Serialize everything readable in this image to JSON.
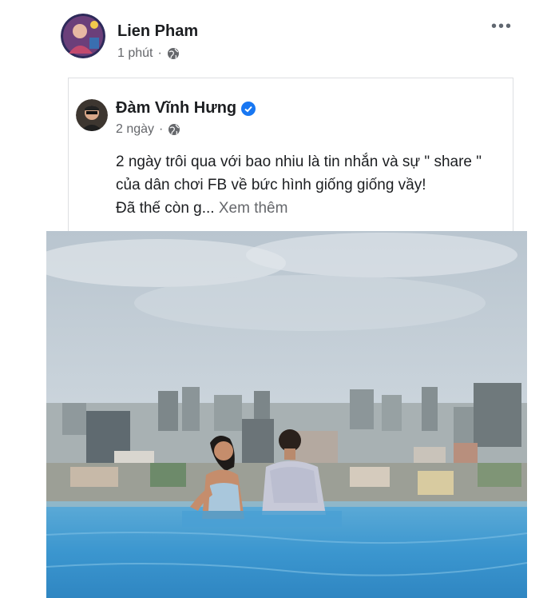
{
  "post": {
    "author_name": "Lien Pham",
    "time": "1 phút",
    "more_icon": "more-horizontal-icon",
    "privacy_icon": "globe-icon"
  },
  "shared_post": {
    "author_name": "Đàm Vĩnh Hưng",
    "verified_icon": "verified-badge-icon",
    "time": "2 ngày",
    "privacy_icon": "globe-icon",
    "text_line1": "2 ngày trôi qua với bao nhiu là tin nhắn và sự \" share \"",
    "text_line2": "của dân chơi FB về bức hình giống giống vầy!",
    "text_line3": "Đã thế còn g...",
    "see_more": "Xem thêm"
  },
  "colors": {
    "text_primary": "#1c1e21",
    "text_secondary": "#65676b",
    "verified_blue": "#1877f2",
    "pool_water": "#3a9bd0",
    "sky": "#c8d3dc"
  }
}
